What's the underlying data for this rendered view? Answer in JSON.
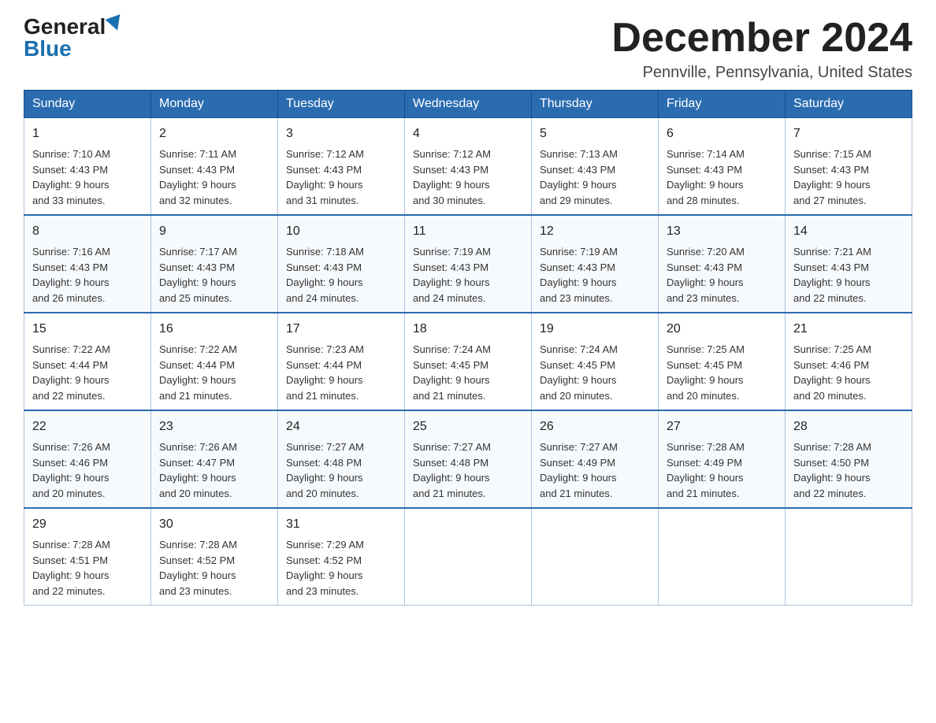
{
  "logo": {
    "general": "General",
    "blue": "Blue"
  },
  "title": {
    "month": "December 2024",
    "location": "Pennville, Pennsylvania, United States"
  },
  "headers": [
    "Sunday",
    "Monday",
    "Tuesday",
    "Wednesday",
    "Thursday",
    "Friday",
    "Saturday"
  ],
  "weeks": [
    [
      {
        "day": "1",
        "sunrise": "7:10 AM",
        "sunset": "4:43 PM",
        "daylight": "9 hours and 33 minutes."
      },
      {
        "day": "2",
        "sunrise": "7:11 AM",
        "sunset": "4:43 PM",
        "daylight": "9 hours and 32 minutes."
      },
      {
        "day": "3",
        "sunrise": "7:12 AM",
        "sunset": "4:43 PM",
        "daylight": "9 hours and 31 minutes."
      },
      {
        "day": "4",
        "sunrise": "7:12 AM",
        "sunset": "4:43 PM",
        "daylight": "9 hours and 30 minutes."
      },
      {
        "day": "5",
        "sunrise": "7:13 AM",
        "sunset": "4:43 PM",
        "daylight": "9 hours and 29 minutes."
      },
      {
        "day": "6",
        "sunrise": "7:14 AM",
        "sunset": "4:43 PM",
        "daylight": "9 hours and 28 minutes."
      },
      {
        "day": "7",
        "sunrise": "7:15 AM",
        "sunset": "4:43 PM",
        "daylight": "9 hours and 27 minutes."
      }
    ],
    [
      {
        "day": "8",
        "sunrise": "7:16 AM",
        "sunset": "4:43 PM",
        "daylight": "9 hours and 26 minutes."
      },
      {
        "day": "9",
        "sunrise": "7:17 AM",
        "sunset": "4:43 PM",
        "daylight": "9 hours and 25 minutes."
      },
      {
        "day": "10",
        "sunrise": "7:18 AM",
        "sunset": "4:43 PM",
        "daylight": "9 hours and 24 minutes."
      },
      {
        "day": "11",
        "sunrise": "7:19 AM",
        "sunset": "4:43 PM",
        "daylight": "9 hours and 24 minutes."
      },
      {
        "day": "12",
        "sunrise": "7:19 AM",
        "sunset": "4:43 PM",
        "daylight": "9 hours and 23 minutes."
      },
      {
        "day": "13",
        "sunrise": "7:20 AM",
        "sunset": "4:43 PM",
        "daylight": "9 hours and 23 minutes."
      },
      {
        "day": "14",
        "sunrise": "7:21 AM",
        "sunset": "4:43 PM",
        "daylight": "9 hours and 22 minutes."
      }
    ],
    [
      {
        "day": "15",
        "sunrise": "7:22 AM",
        "sunset": "4:44 PM",
        "daylight": "9 hours and 22 minutes."
      },
      {
        "day": "16",
        "sunrise": "7:22 AM",
        "sunset": "4:44 PM",
        "daylight": "9 hours and 21 minutes."
      },
      {
        "day": "17",
        "sunrise": "7:23 AM",
        "sunset": "4:44 PM",
        "daylight": "9 hours and 21 minutes."
      },
      {
        "day": "18",
        "sunrise": "7:24 AM",
        "sunset": "4:45 PM",
        "daylight": "9 hours and 21 minutes."
      },
      {
        "day": "19",
        "sunrise": "7:24 AM",
        "sunset": "4:45 PM",
        "daylight": "9 hours and 20 minutes."
      },
      {
        "day": "20",
        "sunrise": "7:25 AM",
        "sunset": "4:45 PM",
        "daylight": "9 hours and 20 minutes."
      },
      {
        "day": "21",
        "sunrise": "7:25 AM",
        "sunset": "4:46 PM",
        "daylight": "9 hours and 20 minutes."
      }
    ],
    [
      {
        "day": "22",
        "sunrise": "7:26 AM",
        "sunset": "4:46 PM",
        "daylight": "9 hours and 20 minutes."
      },
      {
        "day": "23",
        "sunrise": "7:26 AM",
        "sunset": "4:47 PM",
        "daylight": "9 hours and 20 minutes."
      },
      {
        "day": "24",
        "sunrise": "7:27 AM",
        "sunset": "4:48 PM",
        "daylight": "9 hours and 20 minutes."
      },
      {
        "day": "25",
        "sunrise": "7:27 AM",
        "sunset": "4:48 PM",
        "daylight": "9 hours and 21 minutes."
      },
      {
        "day": "26",
        "sunrise": "7:27 AM",
        "sunset": "4:49 PM",
        "daylight": "9 hours and 21 minutes."
      },
      {
        "day": "27",
        "sunrise": "7:28 AM",
        "sunset": "4:49 PM",
        "daylight": "9 hours and 21 minutes."
      },
      {
        "day": "28",
        "sunrise": "7:28 AM",
        "sunset": "4:50 PM",
        "daylight": "9 hours and 22 minutes."
      }
    ],
    [
      {
        "day": "29",
        "sunrise": "7:28 AM",
        "sunset": "4:51 PM",
        "daylight": "9 hours and 22 minutes."
      },
      {
        "day": "30",
        "sunrise": "7:28 AM",
        "sunset": "4:52 PM",
        "daylight": "9 hours and 23 minutes."
      },
      {
        "day": "31",
        "sunrise": "7:29 AM",
        "sunset": "4:52 PM",
        "daylight": "9 hours and 23 minutes."
      },
      null,
      null,
      null,
      null
    ]
  ],
  "labels": {
    "sunrise": "Sunrise:",
    "sunset": "Sunset:",
    "daylight": "Daylight:"
  }
}
